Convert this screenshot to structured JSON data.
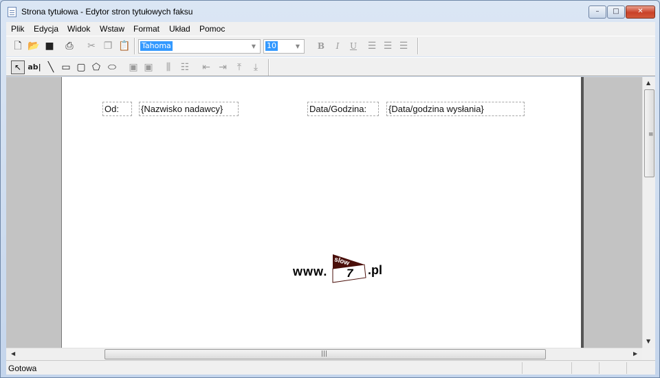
{
  "window": {
    "title": "Strona tytułowa - Edytor stron tytułowych faksu",
    "controls": {
      "minimize": "–",
      "maximize": "□",
      "close": "✕"
    }
  },
  "menubar": {
    "items": [
      "Plik",
      "Edycja",
      "Widok",
      "Wstaw",
      "Format",
      "Układ",
      "Pomoc"
    ]
  },
  "toolbar": {
    "font_name": "Tahoma",
    "font_size": "10",
    "icons": [
      "new-icon",
      "open-icon",
      "save-icon",
      "print-icon",
      "cut-icon",
      "copy-icon",
      "paste-icon",
      "bold-icon",
      "italic-icon",
      "underline-icon",
      "align-left-icon",
      "align-center-icon",
      "align-right-icon"
    ],
    "bold_glyph": "B",
    "italic_glyph": "I",
    "underline_glyph": "U"
  },
  "drawing_toolbar": {
    "text_tool_label": "ab|"
  },
  "page": {
    "from_label": "Od:",
    "from_value": "{Nazwisko nadawcy}",
    "date_label": "Data/Godzina:",
    "date_value": "{Data/godzina wysłania}",
    "logo": {
      "prefix": "www.",
      "badge_top": "slow",
      "badge_digit": "7",
      "suffix": ".pl"
    }
  },
  "statusbar": {
    "text": "Gotowa"
  },
  "colors": {
    "selection": "#3399ff",
    "logo_dark": "#4a0f0a",
    "close_button": "#c94128"
  }
}
